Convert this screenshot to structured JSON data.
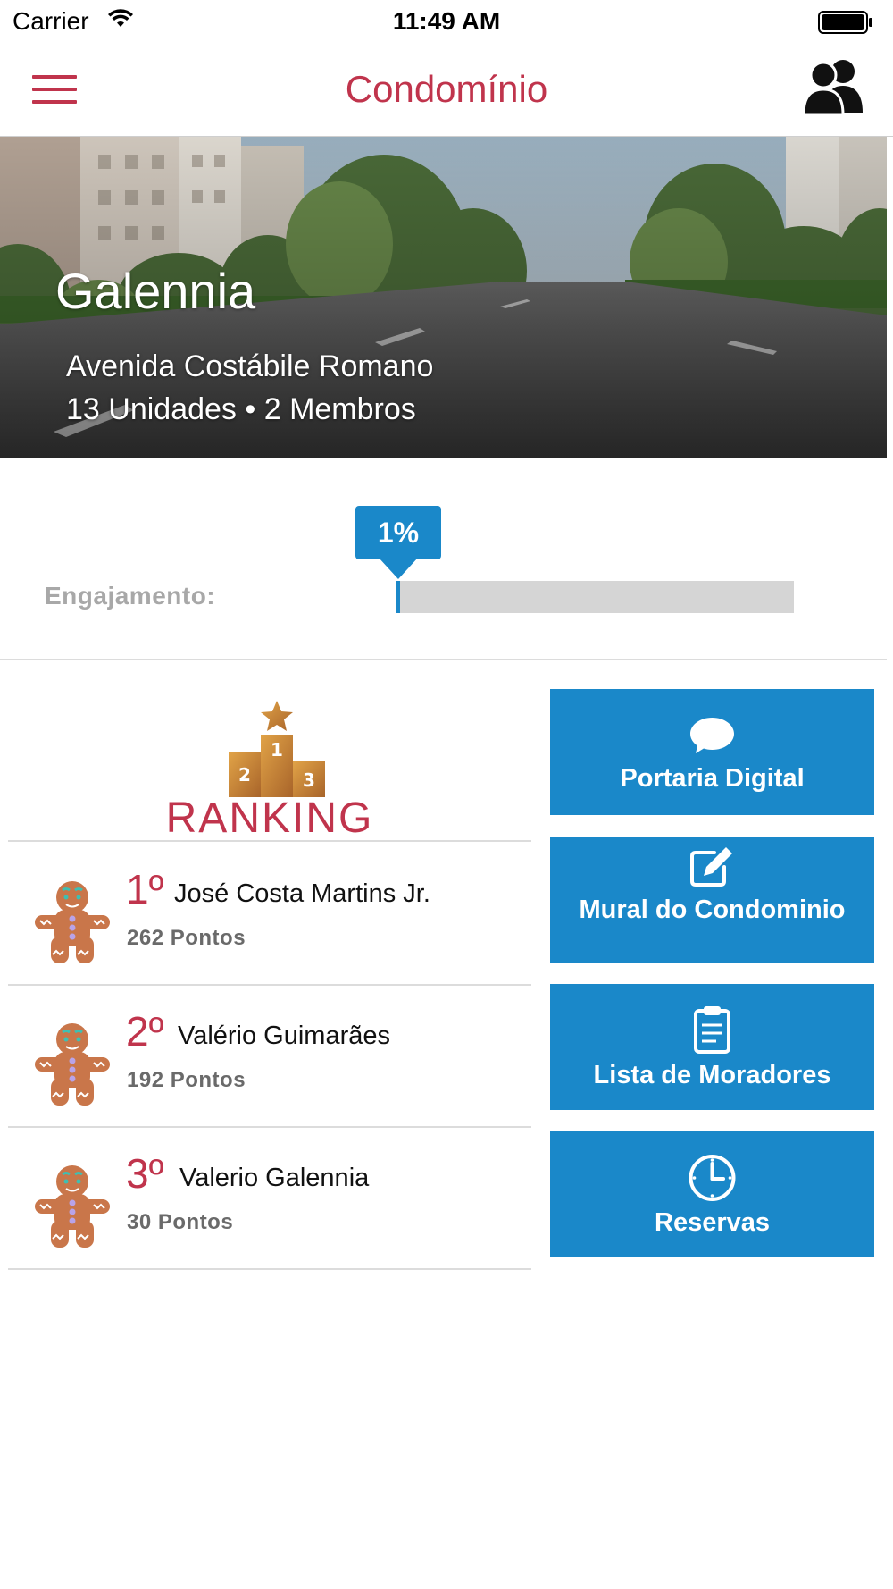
{
  "status_bar": {
    "carrier": "Carrier",
    "time": "11:49 AM"
  },
  "nav": {
    "title": "Condomínio",
    "accent_color": "#c0344c"
  },
  "hero": {
    "name": "Galennia",
    "address": "Avenida Costábile Romano",
    "units_members": "13 Unidades • 2 Membros"
  },
  "engagement": {
    "label": "Engajamento:",
    "percent_text": "1%",
    "percent_value": 1,
    "bar_color": "#1a88c9"
  },
  "ranking": {
    "title": "RANKING",
    "entries": [
      {
        "position": "1º",
        "name": "José Costa Martins Jr.",
        "points": "262 Pontos"
      },
      {
        "position": "2º",
        "name": "Valério Guimarães",
        "points": "192 Pontos"
      },
      {
        "position": "3º",
        "name": "Valerio Galennia",
        "points": "30 Pontos"
      }
    ]
  },
  "actions": [
    {
      "label": "Portaria Digital",
      "icon": "chat-bubble-icon"
    },
    {
      "label": "Mural do Condominio",
      "icon": "edit-icon"
    },
    {
      "label": "Lista de Moradores",
      "icon": "clipboard-icon"
    },
    {
      "label": "Reservas",
      "icon": "clock-icon"
    }
  ],
  "button_color": "#1a88c9"
}
